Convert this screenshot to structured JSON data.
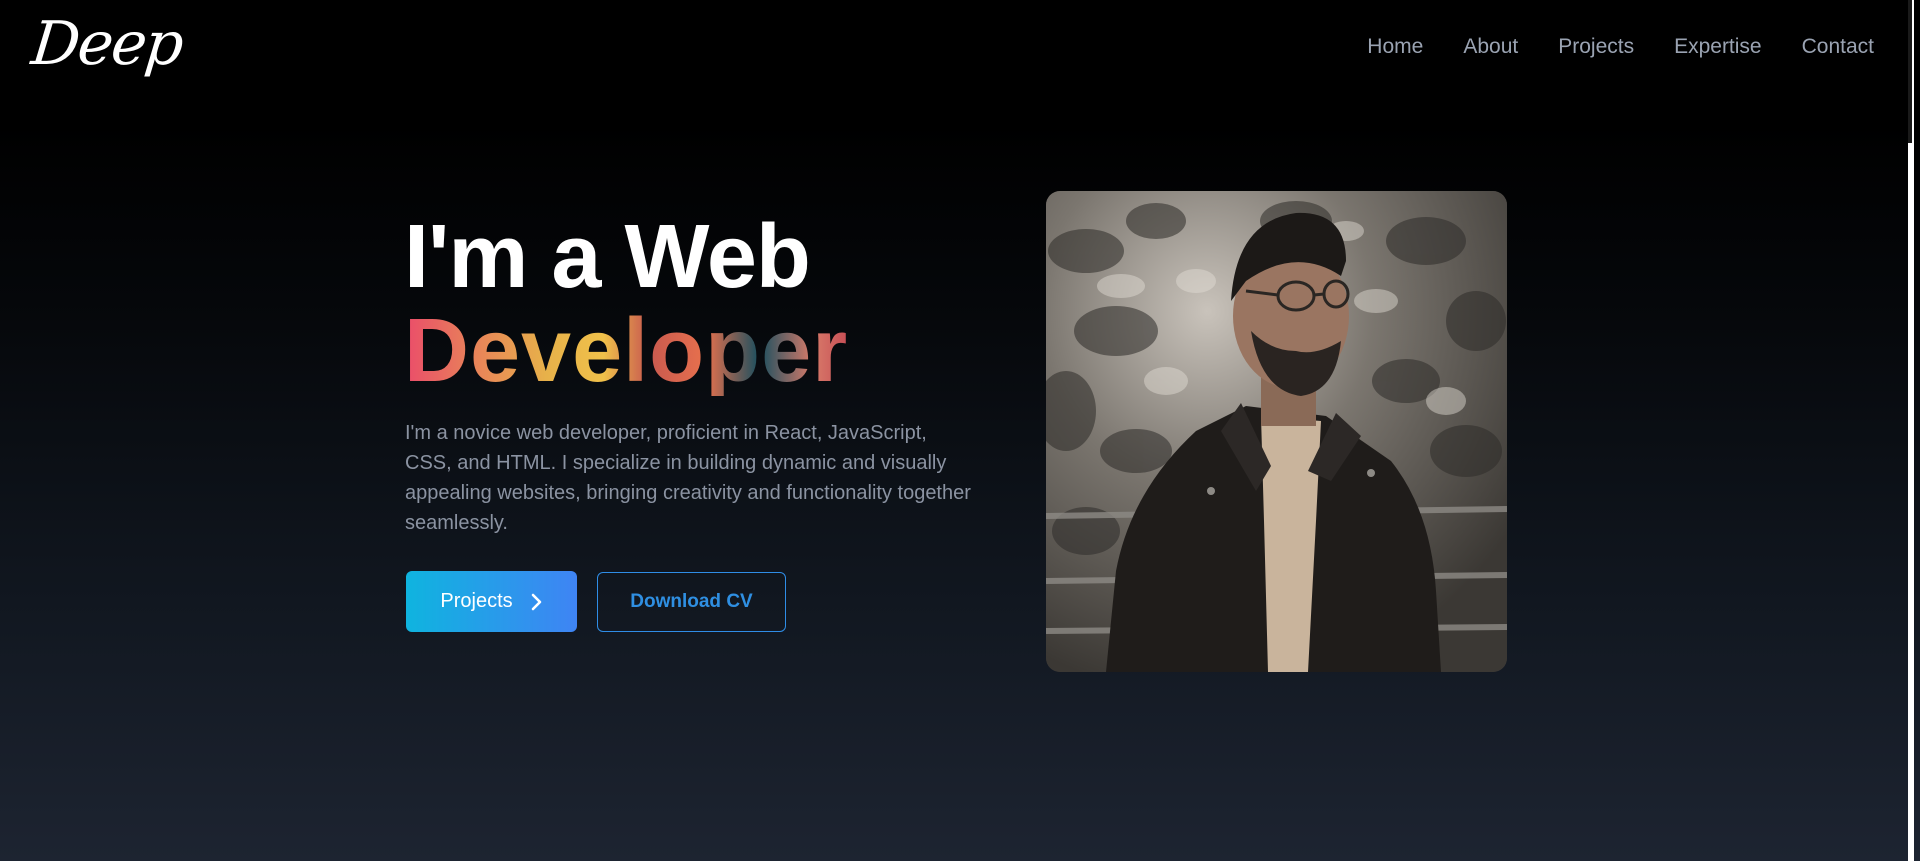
{
  "brand": {
    "logo_text": "Deep"
  },
  "nav": {
    "items": [
      {
        "label": "Home"
      },
      {
        "label": "About"
      },
      {
        "label": "Projects"
      },
      {
        "label": "Expertise"
      },
      {
        "label": "Contact"
      }
    ]
  },
  "hero": {
    "title_line1": "I'm a Web",
    "title_line2": "Developer",
    "description": "I'm a novice web developer, proficient in React, JavaScript, CSS, and HTML. I specialize in building dynamic and visually appealing websites, bringing creativity and functionality together seamlessly.",
    "projects_button": "Projects",
    "projects_button_icon": "chevron-right-icon",
    "download_button": "Download CV"
  },
  "colors": {
    "accent_start": "#0fb4df",
    "accent_end": "#3f84f4",
    "outline_button": "#2f8de6",
    "nav_text": "#9aa3b2",
    "body_text": "#8b93a2"
  }
}
